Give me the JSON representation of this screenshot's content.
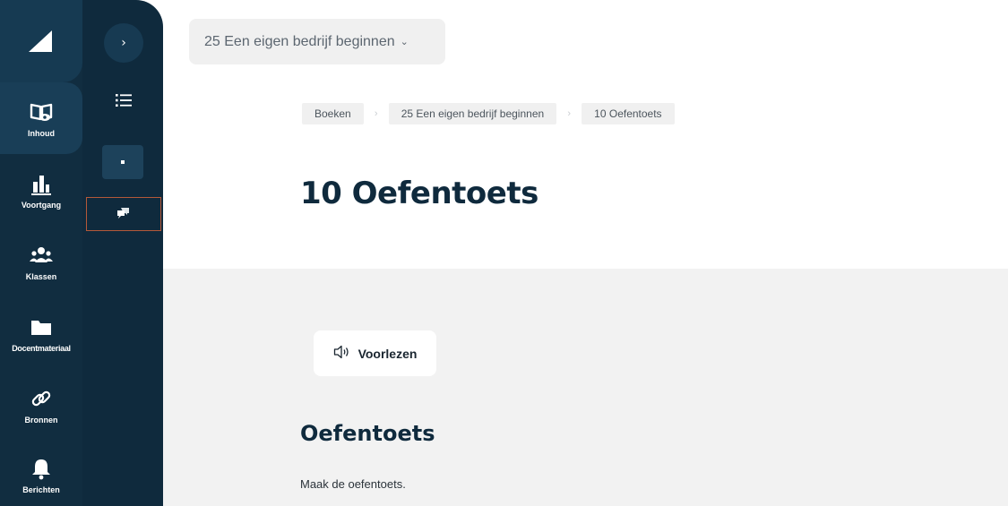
{
  "book_selector": {
    "label": "25 Een eigen bedrijf beginnen",
    "chevron_icon": "chevron-down-icon"
  },
  "breadcrumb": [
    {
      "label": "Boeken"
    },
    {
      "label": "25 Een eigen bedrijf beginnen"
    },
    {
      "label": "10 Oefentoets"
    }
  ],
  "page": {
    "title": "10 Oefentoets"
  },
  "read_aloud": {
    "label": "Voorlezen",
    "icon": "speaker-icon"
  },
  "section": {
    "title": "Oefentoets",
    "text": "Maak de oefentoets."
  },
  "sidebar": {
    "logo_icon": "logo-triangle-icon",
    "items": [
      {
        "label": "Inhoud",
        "icon": "book-eye-icon",
        "active": true
      },
      {
        "label": "Voortgang",
        "icon": "bar-chart-icon",
        "active": false
      },
      {
        "label": "Klassen",
        "icon": "users-icon",
        "active": false
      },
      {
        "label": "Docentmateriaal",
        "icon": "folder-icon",
        "active": false
      },
      {
        "label": "Bronnen",
        "icon": "link-icon",
        "active": false
      },
      {
        "label": "Berichten",
        "icon": "bell-icon",
        "active": false
      }
    ]
  },
  "subnav": {
    "expand_icon": "chevron-right-icon",
    "list_icon": "list-icon",
    "dot_icon": "dot-icon",
    "chat_icon": "chat-bubbles-icon"
  },
  "colors": {
    "sidebar_bg": "#0f2a3d",
    "accent_outline": "#b4593a",
    "title_color": "#0f2a3d",
    "content_bg": "#f2f2f2"
  }
}
